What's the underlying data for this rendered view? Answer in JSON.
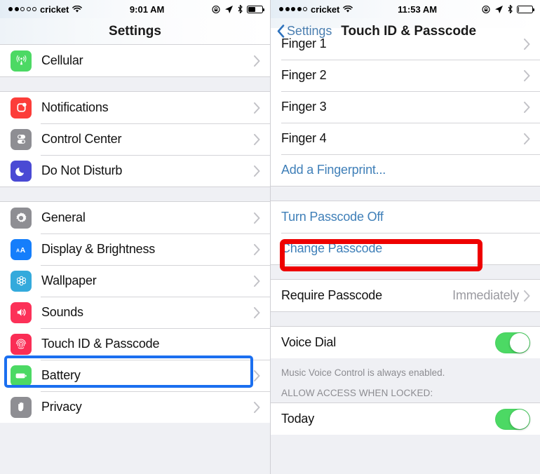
{
  "left": {
    "status": {
      "carrier": "cricket",
      "signal_filled": 2,
      "signal_total": 5,
      "time": "9:01 AM",
      "battery_pct": 55
    },
    "nav": {
      "title": "Settings"
    },
    "groups": [
      {
        "rows": [
          {
            "label": "Cellular",
            "icon": "cellular-icon",
            "icon_color": "#4cd964",
            "chevron": true
          }
        ]
      },
      {
        "rows": [
          {
            "label": "Notifications",
            "icon": "notifications-icon",
            "icon_color": "#fc3d39",
            "chevron": true
          },
          {
            "label": "Control Center",
            "icon": "control-center-icon",
            "icon_color": "#8e8e93",
            "chevron": true
          },
          {
            "label": "Do Not Disturb",
            "icon": "moon-icon",
            "icon_color": "#4a4ad4",
            "chevron": true
          }
        ]
      },
      {
        "rows": [
          {
            "label": "General",
            "icon": "gear-icon",
            "icon_color": "#8e8e93",
            "chevron": true
          },
          {
            "label": "Display & Brightness",
            "icon": "display-brightness-icon",
            "icon_color": "#157efb",
            "chevron": true
          },
          {
            "label": "Wallpaper",
            "icon": "wallpaper-icon",
            "icon_color": "#34aadc",
            "chevron": true
          },
          {
            "label": "Sounds",
            "icon": "sounds-icon",
            "icon_color": "#fc3158",
            "chevron": true
          },
          {
            "label": "Touch ID & Passcode",
            "icon": "touch-id-icon",
            "icon_color": "#fa2d55",
            "chevron": false,
            "highlight": "blue"
          },
          {
            "label": "Battery",
            "icon": "battery-icon",
            "icon_color": "#4cd964",
            "chevron": true
          },
          {
            "label": "Privacy",
            "icon": "privacy-hand-icon",
            "icon_color": "#8e8e93",
            "chevron": true
          }
        ]
      }
    ]
  },
  "right": {
    "status": {
      "carrier": "cricket",
      "signal_filled": 4,
      "signal_total": 5,
      "time": "11:53 AM",
      "battery_pct": 3
    },
    "nav": {
      "back_label": "Settings",
      "title": "Touch ID & Passcode"
    },
    "fingers": [
      {
        "label": "Finger 1",
        "chevron": true,
        "clipped": true
      },
      {
        "label": "Finger 2",
        "chevron": true
      },
      {
        "label": "Finger 3",
        "chevron": true
      },
      {
        "label": "Finger 4",
        "chevron": true
      },
      {
        "label": "Add a Fingerprint...",
        "chevron": false,
        "blue": true
      }
    ],
    "passcode": [
      {
        "label": "Turn Passcode Off",
        "blue": true
      },
      {
        "label": "Change Passcode",
        "blue": true,
        "highlight": "red"
      }
    ],
    "require": {
      "label": "Require Passcode",
      "value": "Immediately",
      "chevron": true
    },
    "voice_dial": {
      "label": "Voice Dial",
      "toggle_on": true
    },
    "footnote": "Music Voice Control is always enabled.",
    "allow_header": "ALLOW ACCESS WHEN LOCKED:",
    "allow_rows": [
      {
        "label": "Today",
        "toggle_on": true
      }
    ]
  },
  "colors": {
    "accent_blue": "#3f7fb8",
    "toggle_green": "#4cd964",
    "highlight_blue": "#1b6ff0",
    "highlight_red": "#ee0000"
  }
}
